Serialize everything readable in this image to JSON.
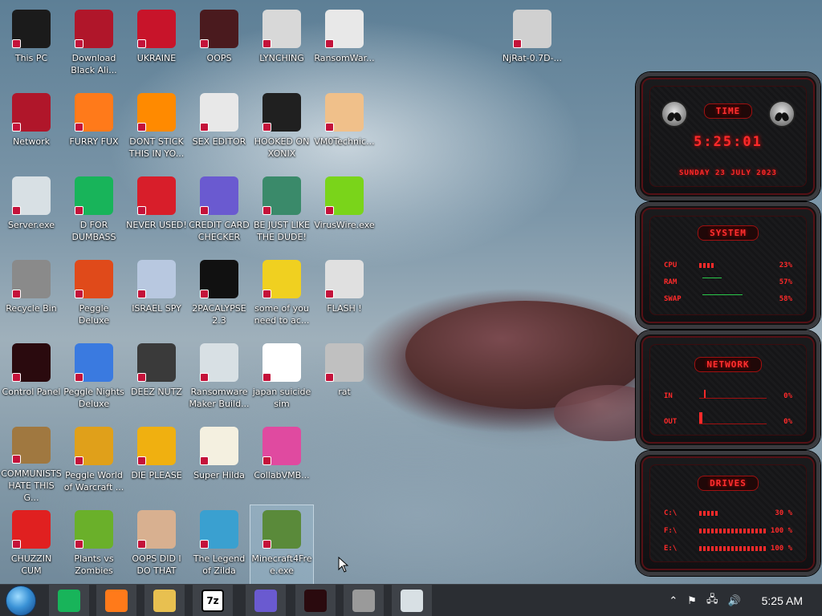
{
  "desktop": {
    "icons": [
      {
        "label": "This PC",
        "icon": "monitor-icon",
        "color": "#1b1b1b"
      },
      {
        "label": "Download Black Ali...",
        "icon": "alien-orb-icon",
        "color": "#b0162a"
      },
      {
        "label": "UKRAINE",
        "icon": "radiation-icon",
        "color": "#c8142a"
      },
      {
        "label": "OOPS",
        "icon": "red-box-icon",
        "color": "#4a1a1e"
      },
      {
        "label": "LYNCHING",
        "icon": "noose-icon",
        "color": "#d8d8d8"
      },
      {
        "label": "RansomWar...",
        "icon": "skull-icon",
        "color": "#e8e8e8"
      },
      {
        "label": "NjRat-0.7D-...",
        "icon": "document-icon",
        "color": "#d0d0d0"
      },
      {
        "label": "Network",
        "icon": "alien-orb-icon",
        "color": "#b0162a"
      },
      {
        "label": "FURRY FUX",
        "icon": "firefox-icon",
        "color": "#ff7a1a"
      },
      {
        "label": "DONT STICK THIS IN YO...",
        "icon": "vlc-cone-icon",
        "color": "#ff8a00"
      },
      {
        "label": "SEX EDITOR",
        "icon": "hxd-icon",
        "color": "#e8e8e8"
      },
      {
        "label": "HOOKED ON XONIX",
        "icon": "maze-icon",
        "color": "#202020"
      },
      {
        "label": "VM0Technic...",
        "icon": "doctor-icon",
        "color": "#f0c08a"
      },
      {
        "label": "Server.exe",
        "icon": "window-icon",
        "color": "#d8e0e4"
      },
      {
        "label": "D FOR DUMBASS",
        "icon": "green-doc-icon",
        "color": "#18b45a"
      },
      {
        "label": "NEVER USED!",
        "icon": "devcpp-icon",
        "color": "#d81e2a"
      },
      {
        "label": "CREDIT CARD CHECKER",
        "icon": "card-icon",
        "color": "#6a5ad0"
      },
      {
        "label": "BE JUST LIKE THE DUDE!",
        "icon": "santa-icon",
        "color": "#3a8a6a"
      },
      {
        "label": "VirusWire.exe",
        "icon": "lime-icon",
        "color": "#7ad41a"
      },
      {
        "label": "Recycle Bin",
        "icon": "trash-icon",
        "color": "#8a8a8a"
      },
      {
        "label": "Peggle Deluxe",
        "icon": "peggle-icon",
        "color": "#e04a1a"
      },
      {
        "label": "ISRAEL SPY",
        "icon": "spy-window-icon",
        "color": "#b8c8e0"
      },
      {
        "label": "2PACALYPSE 2.3",
        "icon": "terminal-icon",
        "color": "#111111"
      },
      {
        "label": "some of you need to ac...",
        "icon": "dog-icon",
        "color": "#f0d020"
      },
      {
        "label": "FLASH !",
        "icon": "flash-doc-icon",
        "color": "#e0e0e0"
      },
      {
        "label": "Control Panel",
        "icon": "control-panel-icon",
        "color": "#2a0a0e"
      },
      {
        "label": "Peggle Nights Deluxe",
        "icon": "peggle-icon",
        "color": "#3a7ae0"
      },
      {
        "label": "DEEZ NUTZ",
        "icon": "stack-icon",
        "color": "#3a3a3a"
      },
      {
        "label": "Ransomware Maker Build...",
        "icon": "window-icon",
        "color": "#d8e0e4"
      },
      {
        "label": "japan suicide sim",
        "icon": "flag-icon",
        "color": "#ffffff"
      },
      {
        "label": "rat",
        "icon": "red-doc-icon",
        "color": "#c0c0c0"
      },
      {
        "label": "COMMUNISTS HATE THIS G...",
        "icon": "money-bag-icon",
        "color": "#a07840"
      },
      {
        "label": "Peggle World of Warcraft ...",
        "icon": "peggle-icon",
        "color": "#e0a01a"
      },
      {
        "label": "DIE PLEASE",
        "icon": "die-icon",
        "color": "#f0b010"
      },
      {
        "label": "Super Hilda",
        "icon": "pixel-hilda-icon",
        "color": "#f4f0e0"
      },
      {
        "label": "CollabVMB...",
        "icon": "pink-monitor-icon",
        "color": "#e04aa0"
      },
      {
        "label": "CHUZZIN CUM",
        "icon": "chuzzle-icon",
        "color": "#e02020"
      },
      {
        "label": "Plants vs Zombies",
        "icon": "plant-icon",
        "color": "#6ab02a"
      },
      {
        "label": "OOPS DID I DO THAT",
        "icon": "portrait-icon",
        "color": "#d8b090"
      },
      {
        "label": "The Legend of Zilda",
        "icon": "pixel-hero-icon",
        "color": "#3aa0d0"
      },
      {
        "label": "Minecraft4Free.exe",
        "icon": "grass-block-icon",
        "color": "#5a8a3a"
      }
    ]
  },
  "widget": {
    "time": {
      "title": "TIME",
      "clock": "5:25:01",
      "date": "SUNDAY 23 JULY 2023"
    },
    "system": {
      "title": "SYSTEM",
      "rows": [
        {
          "label": "CPU",
          "value": "23%",
          "fraction": 0.23
        },
        {
          "label": "RAM",
          "value": "57%",
          "fraction": 0.0
        },
        {
          "label": "SWAP",
          "value": "58%",
          "fraction": 0.0
        }
      ]
    },
    "network": {
      "title": "NETWORK",
      "rows": [
        {
          "label": "IN",
          "value": "0%"
        },
        {
          "label": "OUT",
          "value": "0%"
        }
      ]
    },
    "drives": {
      "title": "DRIVES",
      "rows": [
        {
          "label": "C:\\",
          "value": "30 %",
          "fraction": 0.3
        },
        {
          "label": "F:\\",
          "value": "100 %",
          "fraction": 1.0
        },
        {
          "label": "E:\\",
          "value": "100 %",
          "fraction": 1.0
        }
      ]
    },
    "accent": "#ff2a2a"
  },
  "taskbar": {
    "start": "start-orb-icon",
    "apps": [
      {
        "name": "green-doc-icon",
        "color": "#18b45a",
        "text": ""
      },
      {
        "name": "firefox-icon",
        "color": "#ff7a1a",
        "text": ""
      },
      {
        "name": "file-explorer-icon",
        "color": "#e8c050",
        "text": ""
      },
      {
        "name": "7zip-icon",
        "color": "#ffffff",
        "text": "7z"
      },
      {
        "name": "card-icon",
        "color": "#6a5ad0",
        "text": ""
      },
      {
        "name": "control-panel-icon",
        "color": "#2a0a0e",
        "text": ""
      },
      {
        "name": "brick-wall-icon",
        "color": "#9a9a9a",
        "text": ""
      },
      {
        "name": "window-icon",
        "color": "#d8e0e4",
        "text": ""
      }
    ],
    "clock": "5:25 AM"
  }
}
